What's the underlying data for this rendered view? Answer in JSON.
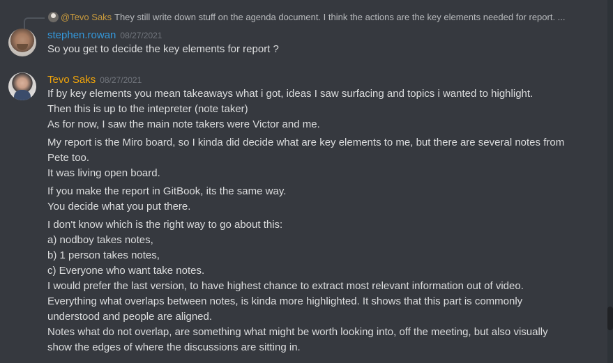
{
  "reply": {
    "author": "@Tevo Saks",
    "text": "They still write down stuff on the agenda document. I think the actions are the key elements needed for report. ..."
  },
  "messages": [
    {
      "author": "stephen.rowan",
      "timestamp": "08/27/2021",
      "lines": [
        "So you get to decide the key elements for report ?"
      ]
    },
    {
      "author": "Tevo Saks",
      "timestamp": "08/27/2021",
      "lines": [
        "If by key elements you mean takeaways what i got, ideas I saw surfacing and topics i wanted to highlight.",
        "Then this is up to the intepreter (note taker)",
        "As for now, I saw the main note takers were Victor and me.",
        "My  report is the Miro board, so I kinda did decide what are key elements to me, but there are several notes from",
        "Pete too.",
        "It was living open board.",
        "If you make the report in GitBook, its the same way.",
        "You decide what you put there.",
        "I don't know which is the right way to go about this:",
        "a) nodboy takes notes,",
        "b) 1 person takes notes,",
        "c) Everyone who want take notes.",
        "I would prefer the last version, to have highest chance to extract most relevant information out of video.",
        "Everything what overlaps between notes, is kinda more highlighted. It shows that this part is commonly",
        "understood and people are aligned.",
        "Notes what do not overlap, are something what might be worth looking into, off the meeting, but also visually",
        "show the edges of where the discussions are sitting in."
      ]
    }
  ],
  "colors": {
    "background": "#36393f",
    "stephen_name": "#3498db",
    "tevo_name": "#f1a50a",
    "reply_author": "#c89a3e",
    "text": "#dcddde",
    "timestamp": "#72767d"
  }
}
